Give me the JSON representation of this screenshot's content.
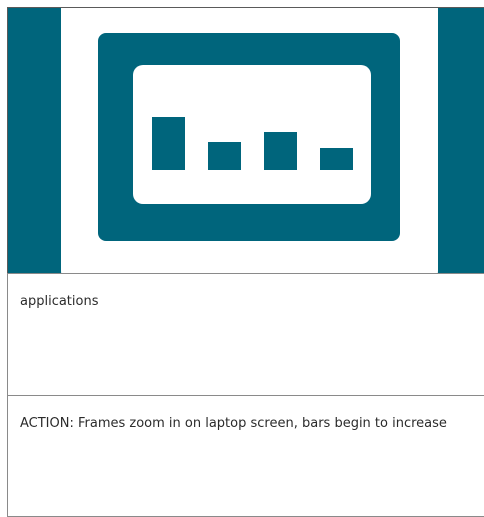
{
  "frame": {
    "illustration": "laptop-screen-with-bar-chart",
    "colors": {
      "background": "#00657c",
      "device": "#ffffff",
      "screen": "#00657c",
      "bars": "#00657c"
    },
    "bars_relative_heights": [
      1.0,
      0.52,
      0.72,
      0.42
    ]
  },
  "rows": [
    {
      "text": "applications"
    },
    {
      "text": "ACTION: Frames zoom in on laptop screen, bars begin to increase"
    }
  ]
}
